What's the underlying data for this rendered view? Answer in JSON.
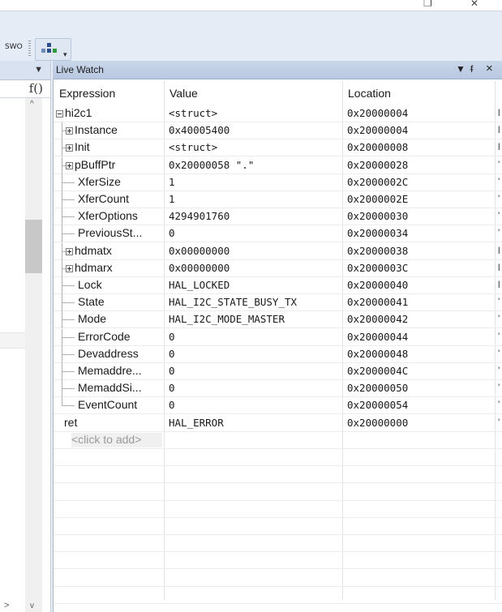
{
  "toolbar": {
    "swo_label": "SWO",
    "colors": {
      "toolbar_bg": "#e6ecf5",
      "title_bg": "#c9d6ea"
    }
  },
  "window_controls": {
    "restore_icon": "restore-icon",
    "close_icon": "close-icon",
    "restore_glyph": "❐",
    "close_glyph": "✕"
  },
  "left_pane": {
    "dropdown_glyph": "▼",
    "fx_label": "f()",
    "scroll_up": "^",
    "scroll_down": "v",
    "h_right": ">"
  },
  "live_watch": {
    "title": "Live Watch",
    "buttons": {
      "dropdown": "▼",
      "pin": "ᵮ",
      "close": "×"
    },
    "columns": [
      "Expression",
      "Value",
      "Location"
    ],
    "rows": [
      {
        "expr": "hi2c1",
        "value": "<struct>",
        "location": "0x20000004",
        "tail": "l",
        "level": 0,
        "expander": "minus"
      },
      {
        "expr": "Instance",
        "value": "0x40005400",
        "location": "0x20000004",
        "tail": "l",
        "level": 1,
        "expander": "plus"
      },
      {
        "expr": "Init",
        "value": "<struct>",
        "location": "0x20000008",
        "tail": "l",
        "level": 1,
        "expander": "plus"
      },
      {
        "expr": "pBuffPtr",
        "value": "0x20000058 \".\"",
        "location": "0x20000028",
        "tail": "'",
        "level": 1,
        "expander": "plus"
      },
      {
        "expr": "XferSize",
        "value": "1",
        "location": "0x2000002C",
        "tail": "'",
        "level": 1,
        "expander": "none"
      },
      {
        "expr": "XferCount",
        "value": "1",
        "location": "0x2000002E",
        "tail": "'",
        "level": 1,
        "expander": "none"
      },
      {
        "expr": "XferOptions",
        "value": "4294901760",
        "location": "0x20000030",
        "tail": "'",
        "level": 1,
        "expander": "none"
      },
      {
        "expr": "PreviousSt...",
        "value": "0",
        "location": "0x20000034",
        "tail": "'",
        "level": 1,
        "expander": "none"
      },
      {
        "expr": "hdmatx",
        "value": "0x00000000",
        "location": "0x20000038",
        "tail": "l",
        "level": 1,
        "expander": "plus"
      },
      {
        "expr": "hdmarx",
        "value": "0x00000000",
        "location": "0x2000003C",
        "tail": "l",
        "level": 1,
        "expander": "plus"
      },
      {
        "expr": "Lock",
        "value": "HAL_LOCKED",
        "location": "0x20000040",
        "tail": "l",
        "level": 1,
        "expander": "none"
      },
      {
        "expr": "State",
        "value": "HAL_I2C_STATE_BUSY_TX",
        "location": "0x20000041",
        "tail": "'",
        "level": 1,
        "expander": "none"
      },
      {
        "expr": "Mode",
        "value": "HAL_I2C_MODE_MASTER",
        "location": "0x20000042",
        "tail": "'",
        "level": 1,
        "expander": "none"
      },
      {
        "expr": "ErrorCode",
        "value": "0",
        "location": "0x20000044",
        "tail": "'",
        "level": 1,
        "expander": "none"
      },
      {
        "expr": "Devaddress",
        "value": "0",
        "location": "0x20000048",
        "tail": "'",
        "level": 1,
        "expander": "none"
      },
      {
        "expr": "Memaddre...",
        "value": "0",
        "location": "0x2000004C",
        "tail": "'",
        "level": 1,
        "expander": "none"
      },
      {
        "expr": "MemaddSi...",
        "value": "0",
        "location": "0x20000050",
        "tail": "'",
        "level": 1,
        "expander": "none"
      },
      {
        "expr": "EventCount",
        "value": "0",
        "location": "0x20000054",
        "tail": "'",
        "level": 1,
        "expander": "none"
      },
      {
        "expr": "ret",
        "value": "HAL_ERROR",
        "location": "0x20000000",
        "tail": "'",
        "level": 0,
        "expander": "none"
      }
    ],
    "add_placeholder": "<click to add>",
    "hscroll": {
      "left": "<",
      "right": ">"
    }
  }
}
